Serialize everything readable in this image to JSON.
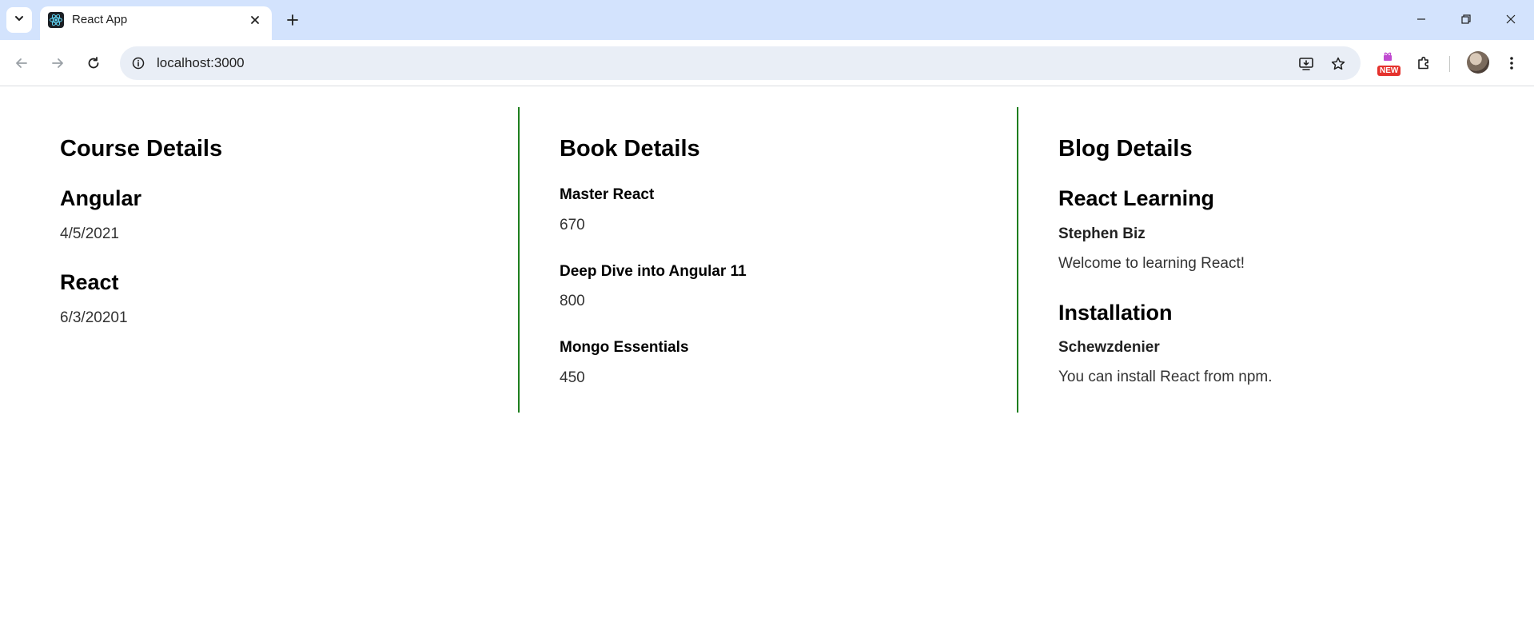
{
  "browser": {
    "tab_title": "React App",
    "url": "localhost:3000",
    "new_badge": "NEW",
    "accent_color": "#d3e3fd"
  },
  "icons": {
    "tab_search": "chevron-down-icon",
    "favicon": "react-logo-icon",
    "close": "close-icon",
    "new_tab": "plus-icon",
    "back": "arrow-left-icon",
    "forward": "arrow-right-icon",
    "reload": "reload-icon",
    "site_info": "info-icon",
    "install": "install-app-icon",
    "bookmark": "star-icon",
    "extension": "puzzle-icon"
  },
  "courses": {
    "title": "Course Details",
    "items": [
      {
        "name": "Angular",
        "date": "4/5/2021"
      },
      {
        "name": "React",
        "date": "6/3/20201"
      }
    ]
  },
  "books": {
    "title": "Book Details",
    "items": [
      {
        "name": "Master React",
        "price": "670"
      },
      {
        "name": "Deep Dive into Angular 11",
        "price": "800"
      },
      {
        "name": "Mongo Essentials",
        "price": "450"
      }
    ]
  },
  "blogs": {
    "title": "Blog Details",
    "items": [
      {
        "title": "React Learning",
        "author": "Stephen Biz",
        "content": "Welcome to learning React!"
      },
      {
        "title": "Installation",
        "author": "Schewzdenier",
        "content": "You can install React from npm."
      }
    ]
  },
  "divider_color": "#1e7e1e"
}
